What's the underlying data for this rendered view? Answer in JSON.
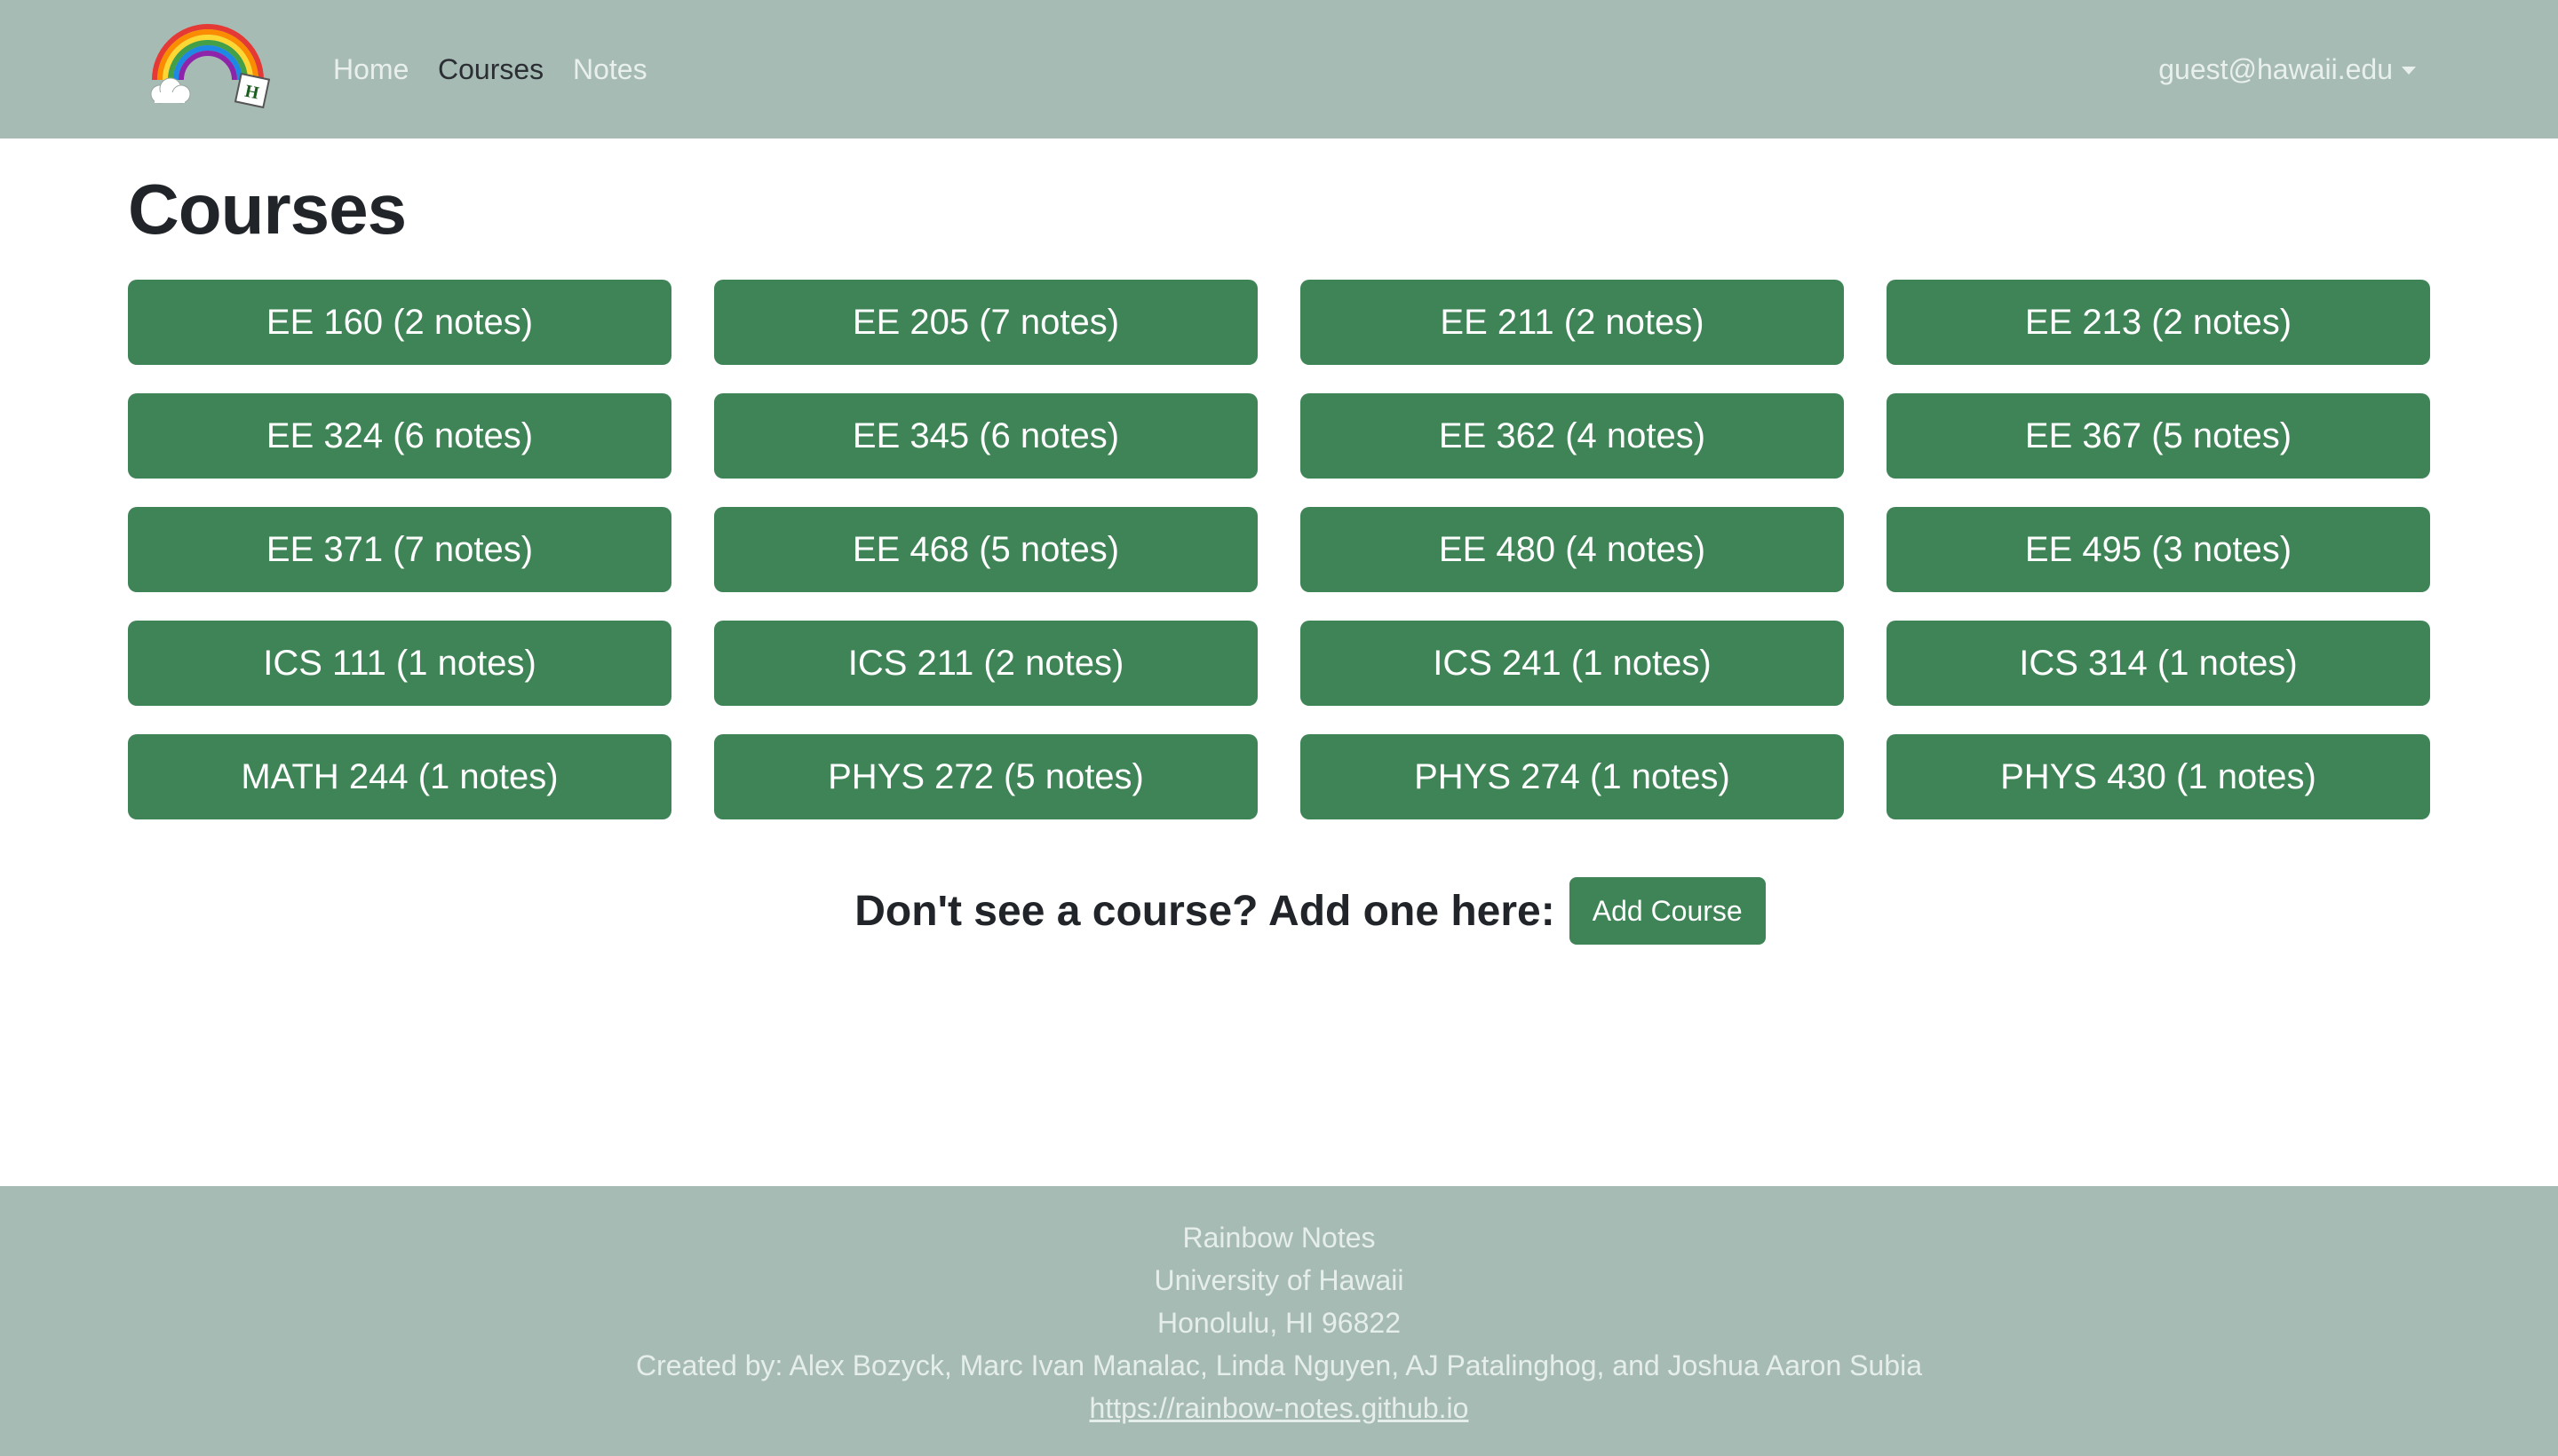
{
  "navbar": {
    "links": [
      {
        "label": "Home"
      },
      {
        "label": "Courses"
      },
      {
        "label": "Notes"
      }
    ],
    "user": "guest@hawaii.edu"
  },
  "page": {
    "title": "Courses"
  },
  "courses": [
    "EE 160 (2 notes)",
    "EE 205 (7 notes)",
    "EE 211 (2 notes)",
    "EE 213 (2 notes)",
    "EE 324 (6 notes)",
    "EE 345 (6 notes)",
    "EE 362 (4 notes)",
    "EE 367 (5 notes)",
    "EE 371 (7 notes)",
    "EE 468 (5 notes)",
    "EE 480 (4 notes)",
    "EE 495 (3 notes)",
    "ICS 111 (1 notes)",
    "ICS 211 (2 notes)",
    "ICS 241 (1 notes)",
    "ICS 314 (1 notes)",
    "MATH 244 (1 notes)",
    "PHYS 272 (5 notes)",
    "PHYS 274 (1 notes)",
    "PHYS 430 (1 notes)"
  ],
  "add_course": {
    "prompt": "Don't see a course? Add one here:",
    "button": "Add Course"
  },
  "footer": {
    "name": "Rainbow Notes",
    "university": "University of Hawaii",
    "address": "Honolulu, HI 96822",
    "credits": "Created by: Alex Bozyck, Marc Ivan Manalac, Linda Nguyen, AJ Patalinghog, and Joshua Aaron Subia",
    "link": "https://rainbow-notes.github.io"
  },
  "colors": {
    "navbar_bg": "#a7bbb5",
    "button_green": "#3f8456",
    "footer_bg": "#a7bbb5"
  },
  "icons": {
    "logo": "rainbow-logo",
    "caret": "caret-down-icon"
  }
}
